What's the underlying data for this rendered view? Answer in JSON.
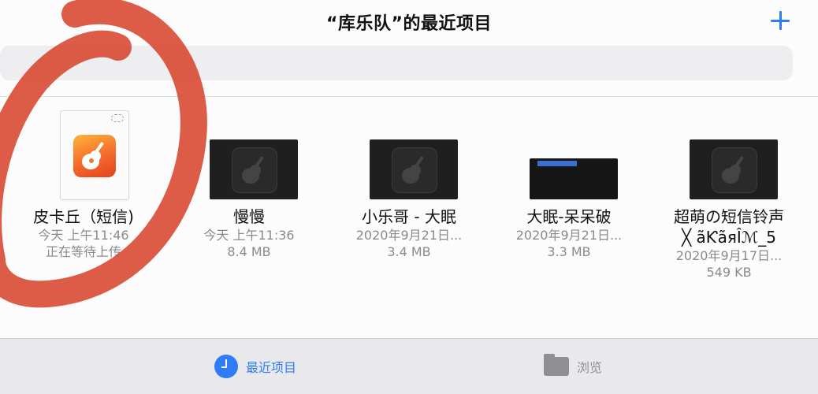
{
  "header": {
    "title": "“库乐队”的最近项目",
    "add_icon": "plus-icon",
    "accent_color": "#2f7cf6"
  },
  "files": [
    {
      "name": "皮卡丘（短信)",
      "meta_line1": "今天 上午11:46",
      "meta_line2": "正在等待上传",
      "thumbnail": "garageband-document-icon"
    },
    {
      "name": "慢慢",
      "meta_line1": "今天 上午11:36",
      "meta_line2": "8.4 MB",
      "thumbnail": "garageband-project-icon"
    },
    {
      "name": "小乐哥 - 大眠",
      "meta_line1": "2020年9月21日...",
      "meta_line2": "3.4 MB",
      "thumbnail": "garageband-project-icon"
    },
    {
      "name": "大眠-呆呆破",
      "meta_line1": "2020年9月21日...",
      "meta_line2": "3.3 MB",
      "thumbnail": "screen-preview"
    },
    {
      "name": "超萌の短信铃声",
      "name_line2": "╳ ãƘãяÎℳ_5",
      "meta_line1": "2020年9月17日...",
      "meta_line2": "549 KB",
      "thumbnail": "garageband-project-icon"
    }
  ],
  "tabbar": {
    "recent_label": "最近项目",
    "recent_icon": "clock-icon",
    "browse_label": "浏览",
    "browse_icon": "folder-icon"
  },
  "annotation": {
    "color": "#d8452e",
    "shape": "hand-drawn-circle"
  }
}
